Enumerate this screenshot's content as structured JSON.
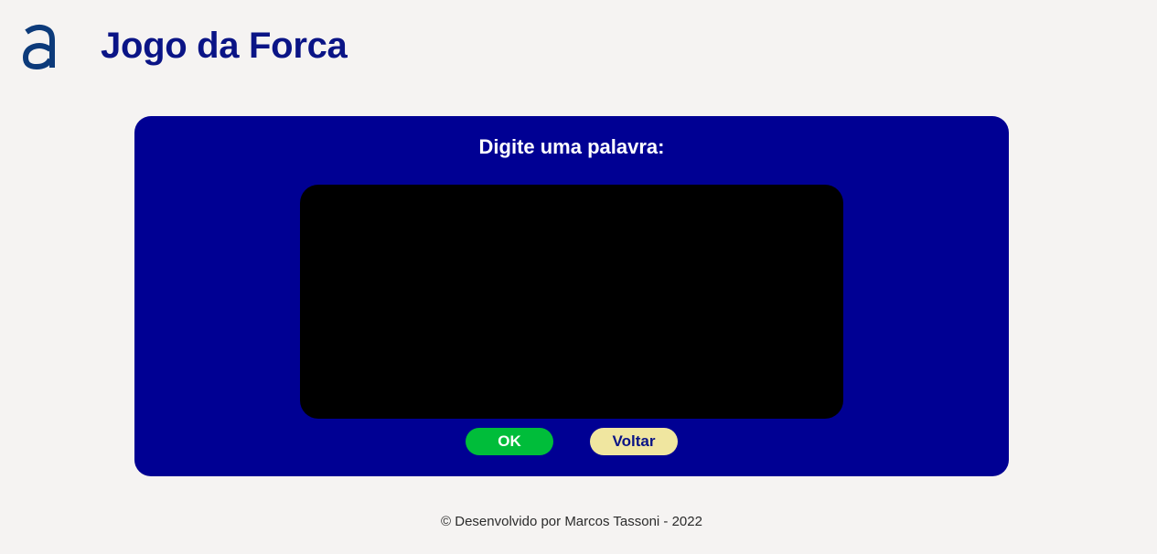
{
  "header": {
    "logo_icon": "alura-a-logo-icon",
    "logo_color": "#0c3a7a",
    "title": "Jogo da Forca"
  },
  "game": {
    "prompt": "Digite uma palavra:",
    "input_value": "",
    "ok_label": "OK",
    "back_label": "Voltar"
  },
  "footer": {
    "text": "© Desenvolvido por Marcos Tassoni - 2022"
  },
  "colors": {
    "background": "#f5f3f2",
    "title": "#0a1486",
    "panel": "#000093",
    "input": "#000000",
    "ok_button": "#00bd3a",
    "back_button": "#f0e6a0"
  }
}
